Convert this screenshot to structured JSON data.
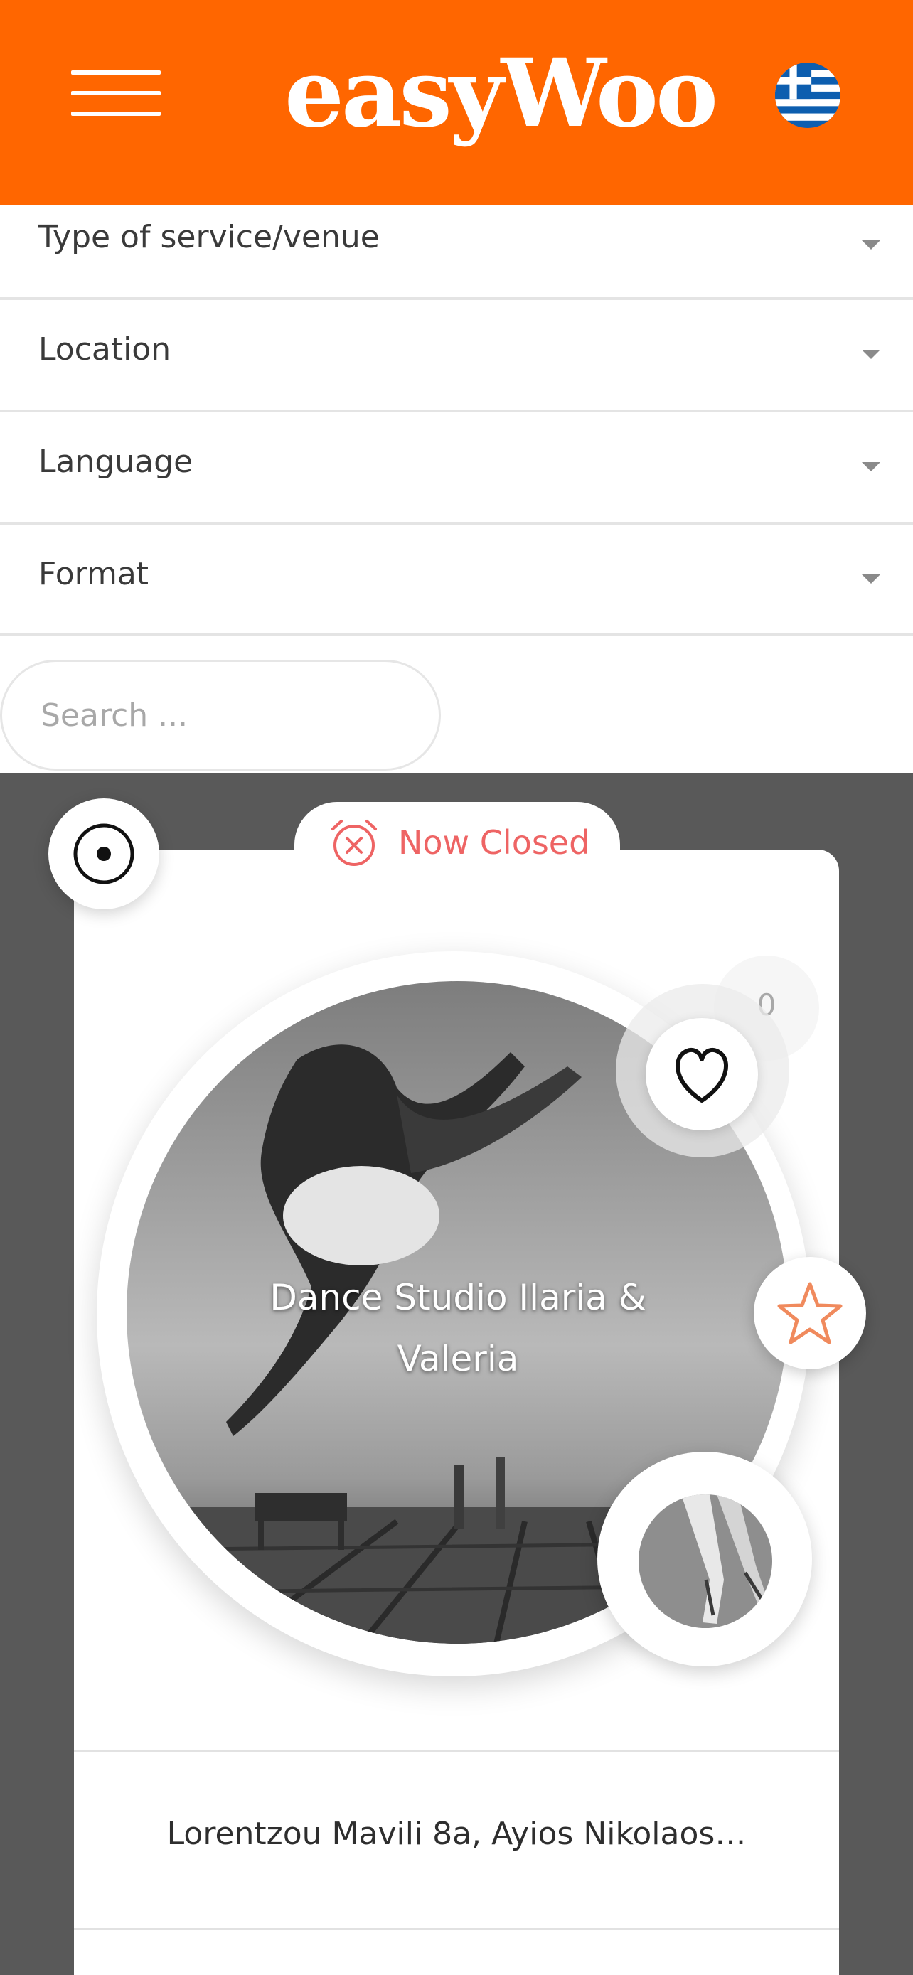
{
  "header": {
    "logo_text": "easyWoo",
    "menu_icon": "hamburger-menu-icon",
    "language_flag": "greek-flag-icon",
    "background_color": "#ff6600"
  },
  "filters": [
    {
      "label": "Type of service/venue"
    },
    {
      "label": "Location"
    },
    {
      "label": "Language"
    },
    {
      "label": "Format"
    }
  ],
  "search": {
    "placeholder": "Search ..."
  },
  "listing": {
    "status": "Now Closed",
    "status_color": "#ee6464",
    "title": "Dance Studio Ilaria & Valeria",
    "likes_count": "0",
    "address": "Lorentzou Mavili 8a, Ayios Nikolaos…",
    "icons": [
      "locate-target-icon",
      "closed-clock-icon",
      "heart-icon",
      "star-icon"
    ],
    "star_color": "#f08a5d"
  }
}
